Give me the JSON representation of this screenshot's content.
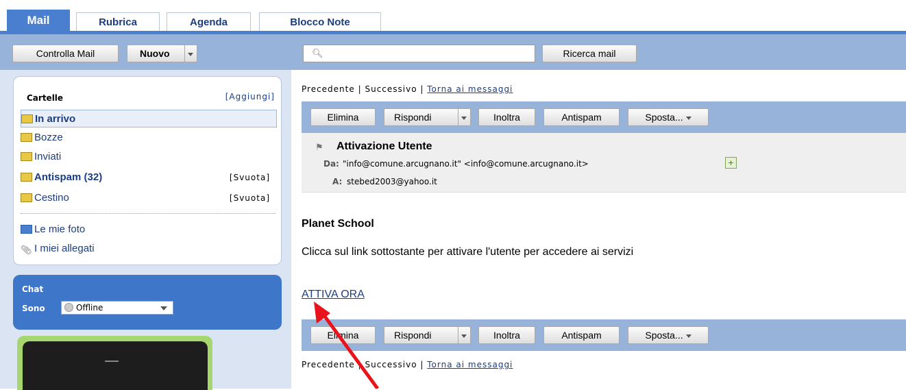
{
  "tabs": [
    "Mail",
    "Rubrica",
    "Agenda",
    "Blocco Note"
  ],
  "toolbar": {
    "check_mail": "Controlla Mail",
    "new": "Nuovo",
    "search_placeholder": "",
    "search_button": "Ricerca mail"
  },
  "folders": {
    "title": "Cartelle",
    "add": "[Aggiungi]",
    "items": [
      {
        "label": "In arrivo",
        "action": "",
        "icon": "inbox-icon"
      },
      {
        "label": "Bozze",
        "action": "",
        "icon": "drafts-icon"
      },
      {
        "label": "Inviati",
        "action": "",
        "icon": "sent-icon"
      },
      {
        "label": "Antispam (32)",
        "action": "[Svuota]",
        "icon": "spam-folder-icon"
      },
      {
        "label": "Cestino",
        "action": "[Svuota]",
        "icon": "trash-icon"
      }
    ],
    "extras": [
      {
        "label": "Le mie foto",
        "icon": "photo-icon"
      },
      {
        "label": "I miei allegati",
        "icon": "paperclip-icon"
      }
    ]
  },
  "chat": {
    "title": "Chat",
    "sono": "Sono",
    "status": "Offline"
  },
  "message_nav": {
    "prev": "Precedente",
    "sep": "|",
    "next": "Successivo",
    "back": "Torna ai messaggi"
  },
  "actions": {
    "delete": "Elimina",
    "reply": "Rispondi",
    "forward": "Inoltra",
    "spam": "Antispam",
    "move": "Sposta..."
  },
  "message": {
    "subject": "Attivazione Utente",
    "from_label": "Da:",
    "from": "\"info@comune.arcugnano.it\" <info@comune.arcugnano.it>",
    "to_label": "A:",
    "to": "stebed2003@yahoo.it",
    "body_title": "Planet School",
    "body_text": "Clicca sul link sottostante per attivare l'utente per accedere ai servizi",
    "link": "ATTIVA ORA"
  },
  "colors": {
    "tab_active": "#4a7fcf",
    "toolbar": "#98b3d9",
    "link": "#1b3d80",
    "annotation_arrow": "#e8131b"
  }
}
